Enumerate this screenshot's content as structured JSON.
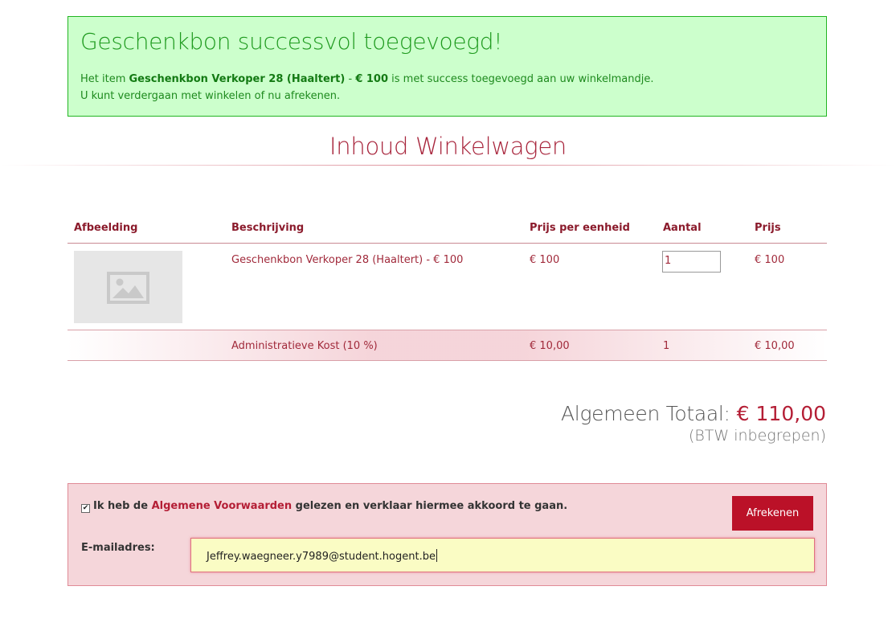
{
  "alert": {
    "title": "Geschenkbon successvol toegevoegd!",
    "line1_prefix": "Het item ",
    "item_name": "Geschenkbon Verkoper 28 (Haaltert)",
    "line1_sep": " - ",
    "item_price": "€ 100",
    "line1_suffix": " is met success toegevoegd aan uw winkelmandje.",
    "line2": "U kunt verdergaan met winkelen of nu afrekenen.",
    "colors": {
      "background": "#ccffcc",
      "border": "#22b522",
      "text": "#1e9a1e"
    }
  },
  "cart": {
    "title": "Inhoud Winkelwagen",
    "columns": [
      "Afbeelding",
      "Beschrijving",
      "Prijs per eenheid",
      "Aantal",
      "Prijs"
    ],
    "items": [
      {
        "image": "image-placeholder-icon",
        "description": "Geschenkbon Verkoper 28 (Haaltert) - € 100",
        "unit_price": "€ 100",
        "quantity": "1",
        "price": "€ 100"
      }
    ],
    "fee": {
      "description": "Administratieve Kost (10 %)",
      "unit_price": "€ 10,00",
      "quantity": "1",
      "price": "€ 10,00"
    }
  },
  "total": {
    "label": "Algemeen Totaal:",
    "amount": "€ 110,00",
    "note": "(BTW inbegrepen)"
  },
  "checkout": {
    "agree_checked": true,
    "agree_prefix": "Ik heb de ",
    "agree_link": "Algemene Voorwaarden",
    "agree_suffix": " gelezen en verklaar hiermee akkoord te gaan.",
    "button_label": "Afrekenen",
    "email_label": "E-mailadres:",
    "email_value": "Jeffrey.waegneer.y7989@student.hogent.be",
    "colors": {
      "panel": "#f5d6da",
      "button": "#bb1128",
      "input": "#fafcc4"
    }
  },
  "colors": {
    "accent": "#a8253c"
  }
}
